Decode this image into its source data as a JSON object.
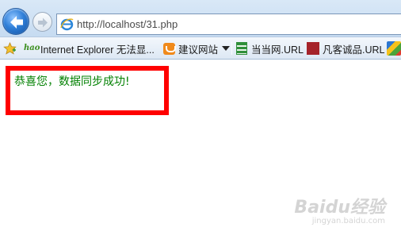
{
  "browser": {
    "address_url": "http://localhost/31.php",
    "back_icon": "back-arrow-icon",
    "forward_icon": "forward-arrow-icon",
    "site_icon": "ie-logo-icon"
  },
  "favorites_bar": {
    "items": [
      {
        "label": "Internet Explorer 无法显...",
        "icon": "hao-icon"
      },
      {
        "label": "建议网站",
        "icon": "suggested-sites-icon"
      },
      {
        "label": "当当网.URL",
        "icon": "dangdang-icon"
      },
      {
        "label": "凡客诚品.URL",
        "icon": "vancl-icon"
      }
    ]
  },
  "page": {
    "message": "恭喜您，数据同步成功!",
    "box_color": "#ff0000",
    "text_color": "#008000"
  },
  "watermark": {
    "brand": "Baidu经验",
    "sub": "jingyan.baidu.com"
  }
}
